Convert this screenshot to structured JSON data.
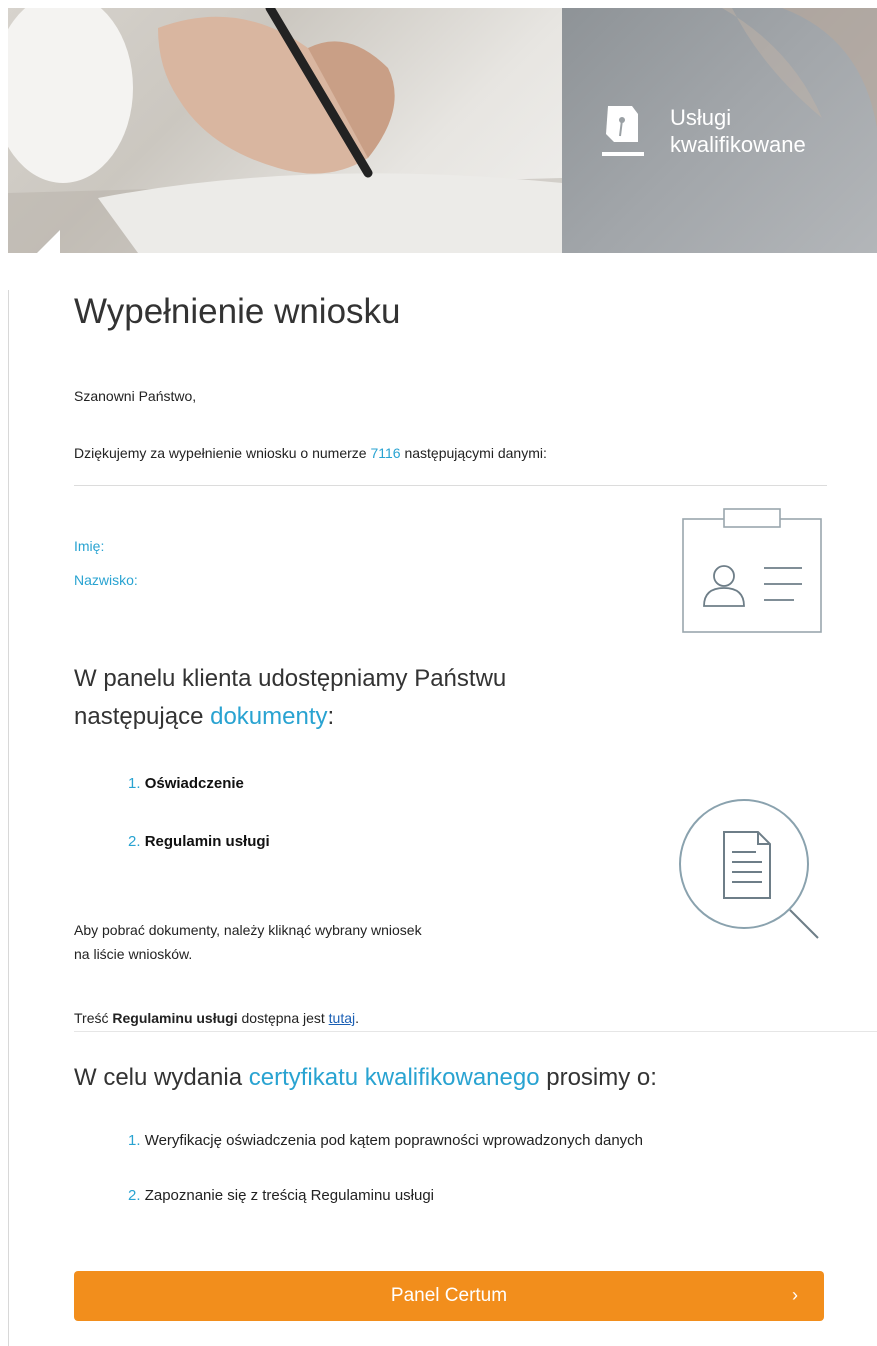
{
  "brand": {
    "line1": "Usługi",
    "line2": "kwalifikowane"
  },
  "title": "Wypełnienie wniosku",
  "greeting": "Szanowni Państwo,",
  "thanks": {
    "before": "Dziękujemy za wypełnienie wniosku o numerze ",
    "number": "7116",
    "after": " następującymi danymi:"
  },
  "fields": {
    "first_name_label": "Imię:",
    "last_name_label": "Nazwisko:"
  },
  "docs_heading": {
    "line1": "W panelu klienta udostępniamy Państwu",
    "line2_before": "następujące ",
    "line2_accent": "dokumenty",
    "line2_after": ":"
  },
  "documents": [
    {
      "num": "1.",
      "label": "Oświadczenie"
    },
    {
      "num": "2.",
      "label": "Regulamin usługi"
    }
  ],
  "download_info": {
    "line1": "Aby pobrać dokumenty, należy kliknąć wybrany wniosek",
    "line2": "na liście wniosków."
  },
  "terms": {
    "before": "Treść ",
    "bold": "Regulaminu usługi",
    "middle": " dostępna jest ",
    "link": "tutaj",
    "after": "."
  },
  "cert_heading": {
    "before": "W celu wydania ",
    "accent": "certyfikatu kwalifikowanego",
    "after": " prosimy o:"
  },
  "requests": [
    {
      "num": "1.",
      "label": "Weryfikację oświadczenia pod kątem poprawności wprowadzonych danych"
    },
    {
      "num": "2.",
      "label": "Zapoznanie się z treścią Regulaminu usługi"
    }
  ],
  "button": {
    "label": "Panel Certum",
    "chevron": "›"
  },
  "colors": {
    "accent": "#29a3d1",
    "button": "#f28e1c"
  },
  "icons": [
    "pen-nib-logo-icon",
    "id-card-icon",
    "document-search-icon",
    "chevron-right-icon"
  ]
}
